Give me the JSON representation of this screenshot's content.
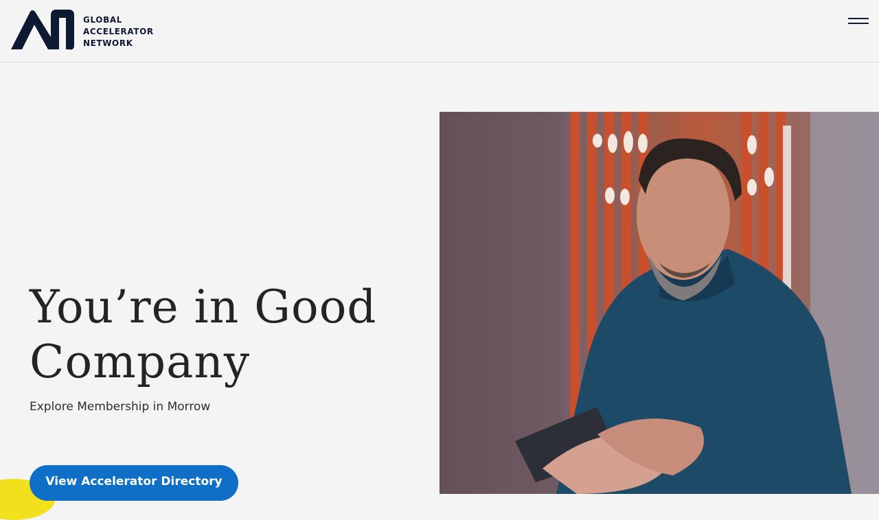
{
  "header": {
    "logo_lines": [
      "GLOBAL",
      "ACCELERATOR",
      "NETWORK"
    ],
    "menu_icon": "hamburger-menu-icon"
  },
  "hero": {
    "title": "You’re in Good Company",
    "subtitle": "Explore Membership in Morrow",
    "cta_label": "View Accelerator Directory"
  },
  "colors": {
    "background": "#f4f4f4",
    "brand_navy": "#0e1a33",
    "cta_blue": "#0f6fc6",
    "accent_yellow": "#f2df1e"
  }
}
